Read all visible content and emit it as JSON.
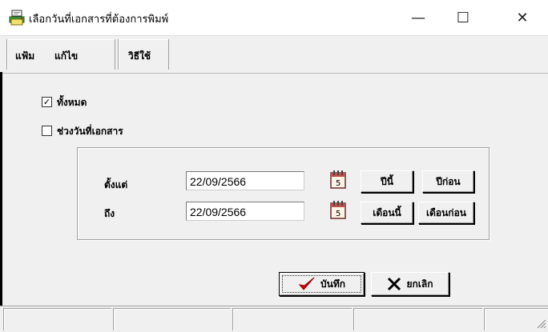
{
  "window": {
    "title": "เลือกวันที่เอกสารที่ต้องการพิมพ์",
    "minimize": "—",
    "maximize": "☐",
    "close": "✕"
  },
  "menu": {
    "file": "แฟ้ม",
    "edit": "แก้ไข",
    "howto": "วิธีใช้"
  },
  "options": {
    "all_label": "ทั้งหมด",
    "all_checked": true,
    "range_label": "ช่วงวันที่เอกสาร",
    "range_checked": false
  },
  "range": {
    "from_label": "ตั้งแต่",
    "from_value": "22/09/2566",
    "to_label": "ถึง",
    "to_value": "22/09/2566",
    "this_year": "ปีนี้",
    "last_year": "ปีก่อน",
    "this_month": "เดือนนี้",
    "last_month": "เดือนก่อน"
  },
  "actions": {
    "save": "บันทึก",
    "cancel": "ยกเลิก"
  },
  "icons": {
    "app": "printer-icon",
    "calendar": "calendar-icon",
    "save": "checkmark-icon",
    "cancel": "x-icon"
  },
  "colors": {
    "check_red": "#d40000",
    "calendar_red": "#c0504d"
  }
}
